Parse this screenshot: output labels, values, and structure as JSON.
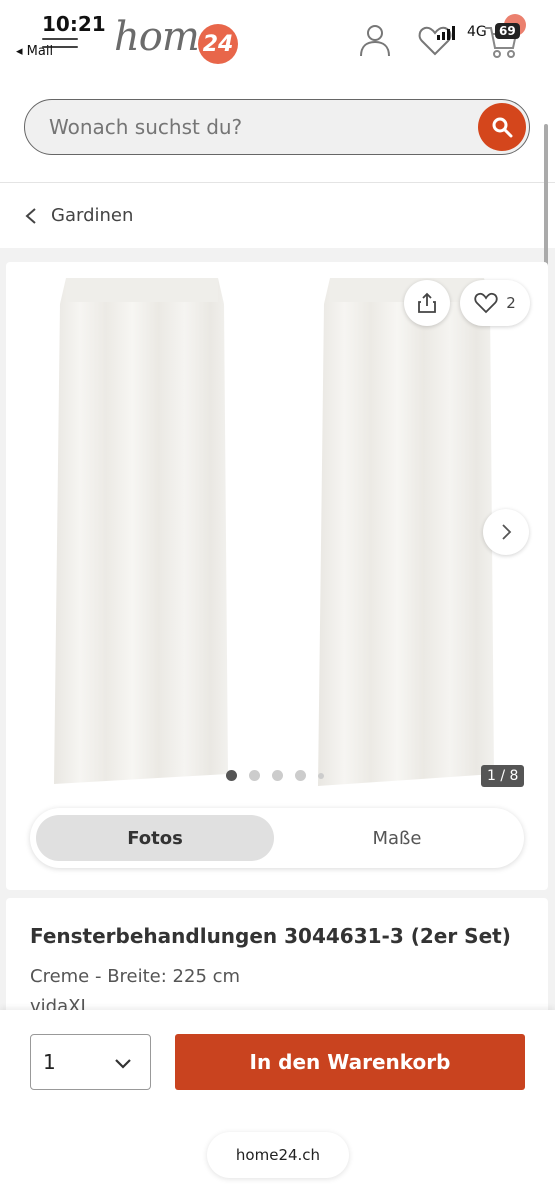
{
  "status": {
    "time": "10:21",
    "back_label": "◂ Mail",
    "network": "4G",
    "battery": "69"
  },
  "header": {
    "logo_text": "home",
    "logo_badge": "24"
  },
  "search": {
    "placeholder": "Wonach suchst du?"
  },
  "breadcrumb": {
    "label": "Gardinen"
  },
  "gallery": {
    "favorites_count": "2",
    "counter": "1 / 8",
    "dots": 5,
    "active_dot": 1
  },
  "tabs": {
    "fotos": "Fotos",
    "masse": "Maße"
  },
  "product": {
    "title": "Fensterbehandlungen 3044631-3 (2er Set)",
    "variant": "Creme - Breite: 225 cm",
    "brand": "vidaXL"
  },
  "purchase": {
    "quantity": "1",
    "cart_label": "In den Warenkorb"
  },
  "browser": {
    "url": "home24.ch"
  },
  "colors": {
    "accent": "#d4461c",
    "badge": "#e8664a"
  }
}
